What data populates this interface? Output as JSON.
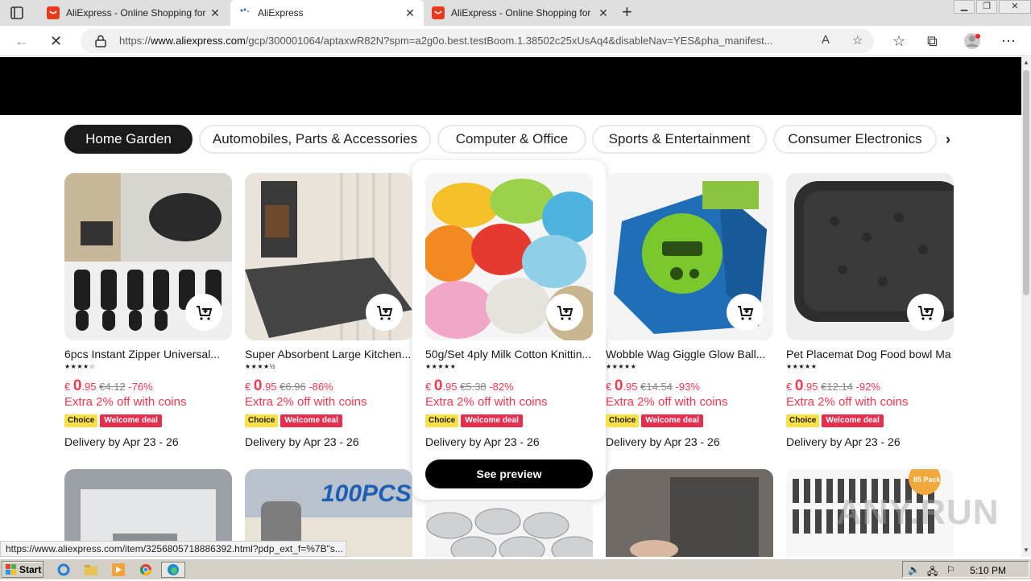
{
  "browser": {
    "tabs": [
      {
        "title": "AliExpress - Online Shopping for",
        "active": false
      },
      {
        "title": "AliExpress",
        "active": true
      },
      {
        "title": "AliExpress - Online Shopping for",
        "active": false
      }
    ],
    "url_prefix": "https://",
    "url_domain": "www.aliexpress.com",
    "url_rest": "/gcp/300001064/aptaxwR82N?spm=a2g0o.best.testBoom.1.38502c25xUsAq4&disableNav=YES&pha_manifest...",
    "status_link": "https://www.aliexpress.com/item/3256805718886392.html?pdp_ext_f=%7B\"s..."
  },
  "categories": [
    "Home Garden",
    "Automobiles, Parts & Accessories",
    "Computer & Office",
    "Sports & Entertainment",
    "Consumer Electronics"
  ],
  "products": [
    {
      "title": "6pcs Instant Zipper Universal...",
      "stars": "★★★★☆",
      "currency": "€",
      "price_int": "0",
      "price_dec": ".95",
      "orig": "€4.12",
      "discount": "-76%",
      "coins": "Extra 2% off with coins",
      "choice": "Choice",
      "welcome": "Welcome deal",
      "delivery": "Delivery by Apr 23 - 26"
    },
    {
      "title": "Super Absorbent Large Kitchen...",
      "stars": "★★★★½",
      "currency": "€",
      "price_int": "0",
      "price_dec": ".95",
      "orig": "€6.96",
      "discount": "-86%",
      "coins": "Extra 2% off with coins",
      "choice": "Choice",
      "welcome": "Welcome deal",
      "delivery": "Delivery by Apr 23 - 26"
    },
    {
      "title": "50g/Set 4ply Milk Cotton Knittin...",
      "stars": "★★★★★",
      "currency": "€",
      "price_int": "0",
      "price_dec": ".95",
      "orig": "€5.38",
      "discount": "-82%",
      "coins": "Extra 2% off with coins",
      "choice": "Choice",
      "welcome": "Welcome deal",
      "delivery": "Delivery by Apr 23 - 26"
    },
    {
      "title": "Wobble Wag Giggle Glow Ball...",
      "stars": "★★★★★",
      "currency": "€",
      "price_int": "0",
      "price_dec": ".95",
      "orig": "€14.54",
      "discount": "-93%",
      "coins": "Extra 2% off with coins",
      "choice": "Choice",
      "welcome": "Welcome deal",
      "delivery": "Delivery by Apr 23 - 26"
    },
    {
      "title": "Pet Placemat Dog Food bowl Ma...",
      "stars": "★★★★★",
      "currency": "€",
      "price_int": "0",
      "price_dec": ".95",
      "orig": "€12.14",
      "discount": "-92%",
      "coins": "Extra 2% off with coins",
      "choice": "Choice",
      "welcome": "Welcome deal",
      "delivery": "Delivery by Apr 23 - 26"
    }
  ],
  "preview_button": "See preview",
  "row2_labels": {
    "pack": "100PCS",
    "pack85": "85 Pack"
  },
  "taskbar": {
    "start": "Start",
    "clock": "5:10 PM"
  },
  "watermark": "ANY.RUN",
  "colors": {
    "price_red": "#fd384f",
    "choice_yellow": "#fce048",
    "welcome_red": "#e62e4d",
    "active_pill": "#1b1b1b"
  }
}
